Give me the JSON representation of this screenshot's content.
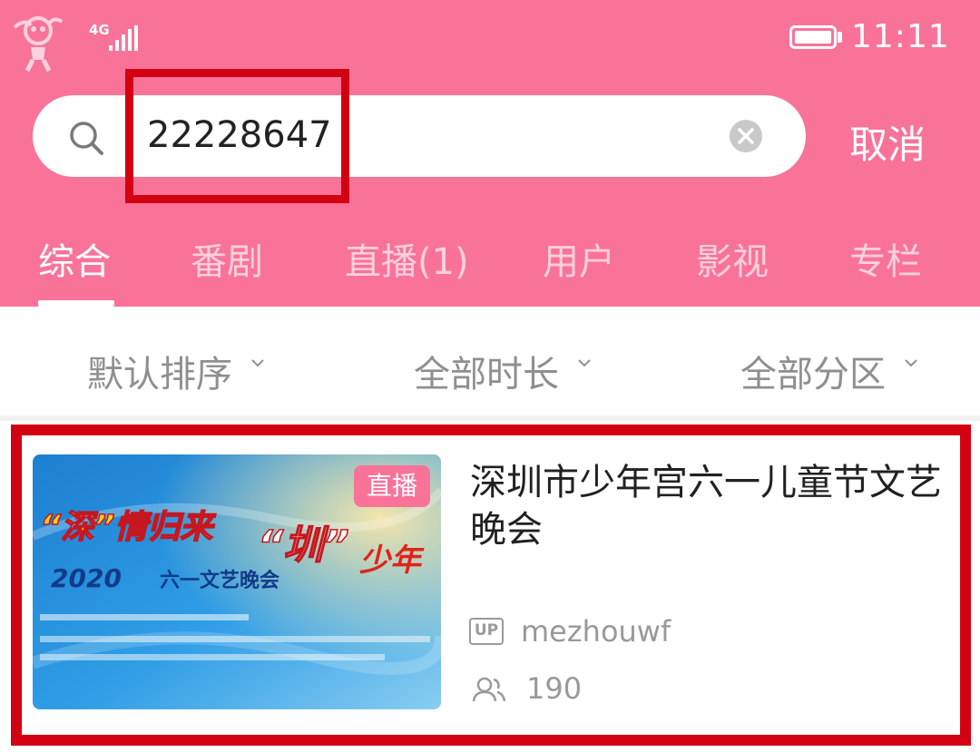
{
  "status_bar": {
    "network": "4G",
    "time": "11:11"
  },
  "search": {
    "query": "22228647",
    "cancel_label": "取消"
  },
  "tabs": [
    {
      "label": "综合",
      "active": true
    },
    {
      "label": "番剧",
      "active": false
    },
    {
      "label": "直播(1)",
      "active": false
    },
    {
      "label": "用户",
      "active": false
    },
    {
      "label": "影视",
      "active": false
    },
    {
      "label": "专栏",
      "active": false
    }
  ],
  "filters": {
    "sort": "默认排序",
    "duration": "全部时长",
    "zone": "全部分区"
  },
  "result": {
    "badge": "直播",
    "title": "深圳市少年宫六一儿童节文艺晚会",
    "uploader": "mezhouwf",
    "up_badge": "UP",
    "viewers": "190",
    "thumbnail": {
      "headline_quote1": "深",
      "headline_mid": "情归来",
      "headline_quote2": "圳",
      "headline_end": "少年",
      "subtitle_year": "2020",
      "subtitle": "六一文艺晚会"
    }
  },
  "colors": {
    "header_pink": "#f97399",
    "highlight_red": "#d30012",
    "tab_inactive": "#fcd0dc",
    "filter_gray": "#8f8f8f"
  }
}
